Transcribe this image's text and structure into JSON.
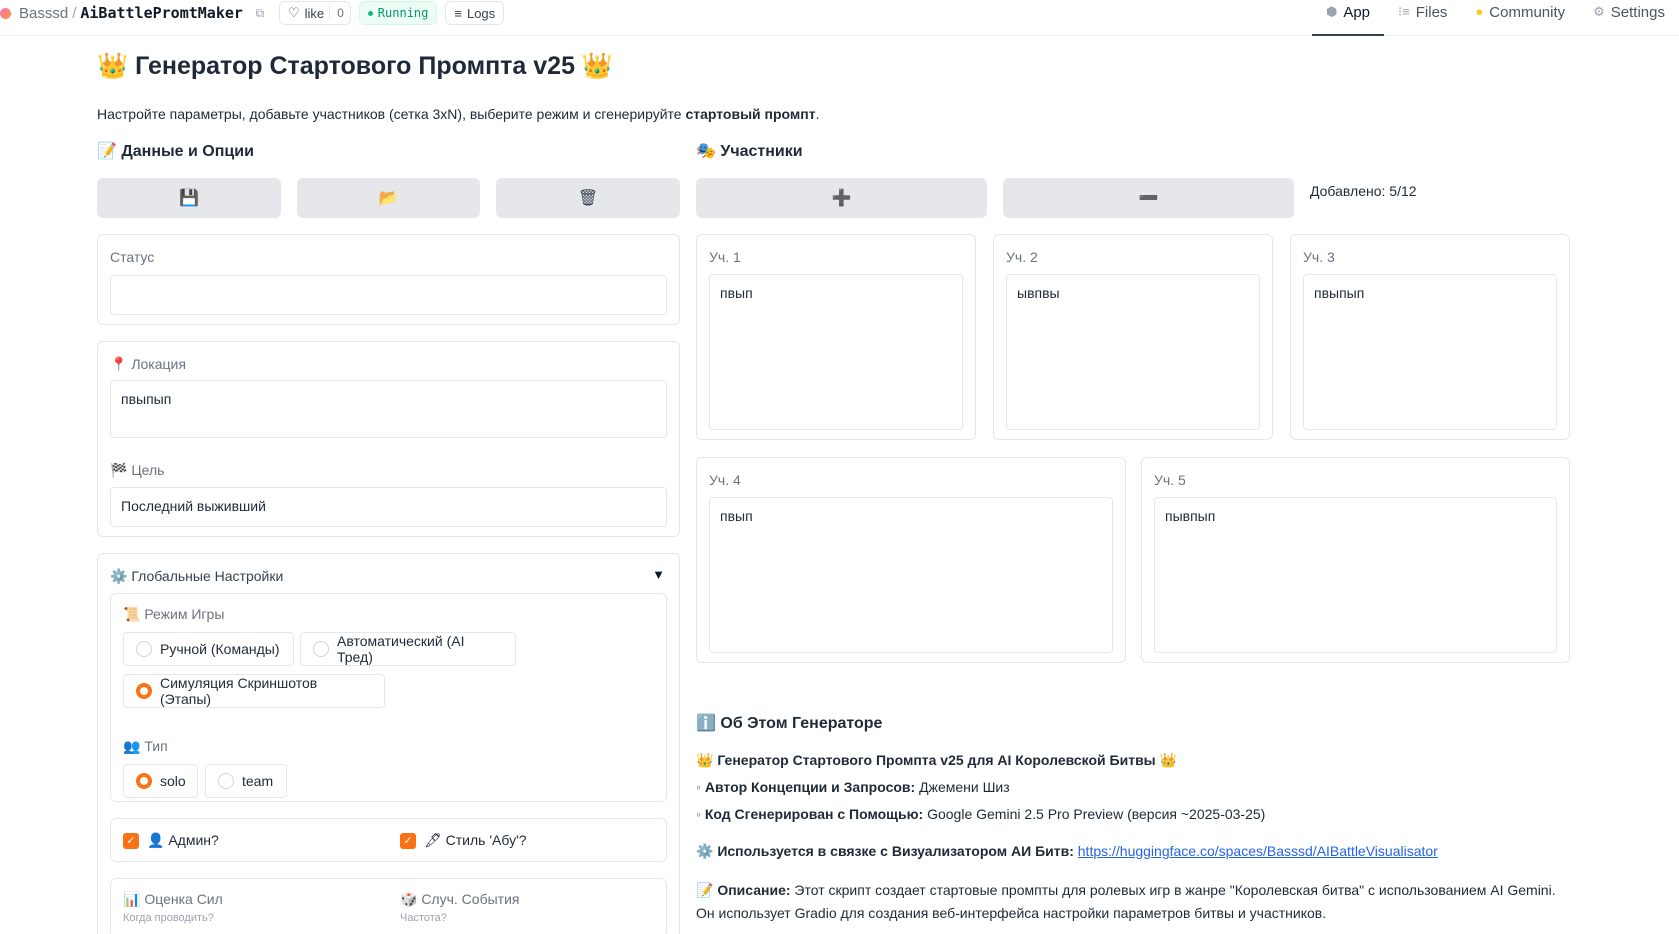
{
  "topbar": {
    "owner": "Basssd",
    "separator": "/",
    "repo": "AiBattlePromtMaker",
    "copy_icon": "⧉",
    "like_icon": "♡",
    "like_label": "like",
    "like_count": "0",
    "status_label": "Running",
    "logs_icon": "≡",
    "logs_label": "Logs",
    "tabs": [
      {
        "icon": "⬢",
        "label": "App"
      },
      {
        "icon": "⁝≡",
        "label": "Files"
      },
      {
        "icon": "●",
        "label": "Community"
      },
      {
        "icon": "⚙",
        "label": "Settings"
      }
    ]
  },
  "page": {
    "title": "👑 Генератор Стартового Промпта v25 👑",
    "description_prefix": "Настройте параметры, добавьте участников (сетка 3xN), выберите режим и сгенерируйте ",
    "description_bold": "стартовый промпт",
    "description_suffix": "."
  },
  "data_options": {
    "heading": "📝 Данные и Опции",
    "save_icon": "💾",
    "load_icon": "📂",
    "delete_icon": "🗑",
    "status_label": "Статус",
    "status_value": "",
    "location_label": "📍 Локация",
    "location_value": "пвыпып",
    "goal_label": "🏁 Цель",
    "goal_value": "Последний выживший",
    "global_settings_label": "⚙️ Глобальные Настройки",
    "collapse_icon": "▼",
    "mode_label": "📜 Режим Игры",
    "mode_options": [
      "Ручной (Команды)",
      "Автоматический (AI Тред)",
      "Симуляция Скриншотов (Этапы)"
    ],
    "mode_selected": "Симуляция Скриншотов (Этапы)",
    "type_label": "👥 Тип",
    "type_options": [
      "solo",
      "team"
    ],
    "type_selected": "solo",
    "admin_label": "👤 Админ?",
    "admin_checked": true,
    "abu_label": "🖋 Стиль 'Абу'?",
    "abu_checked": true,
    "check_mark": "✓",
    "power_label": "📊 Оценка Сил",
    "power_sub": "Когда проводить?",
    "events_label": "🎲 Случ. События",
    "events_sub": "Частота?"
  },
  "participants": {
    "heading": "🎭 Участники",
    "add_icon": "➕",
    "remove_icon": "➖",
    "counter": "Добавлено: 5/12",
    "items": [
      {
        "label": "Уч. 1",
        "value": "пвып"
      },
      {
        "label": "Уч. 2",
        "value": "ывпвы"
      },
      {
        "label": "Уч. 3",
        "value": "пвыпып"
      },
      {
        "label": "Уч. 4",
        "value": "пвып"
      },
      {
        "label": "Уч. 5",
        "value": "пывпып"
      }
    ]
  },
  "about": {
    "heading": "ℹ️ Об Этом Генераторе",
    "subtitle": "👑 Генератор Стартового Промпта v25 для AI Королевской Битвы 👑",
    "bullet": "◦",
    "author_label": "Автор Концепции и Запросов:",
    "author_value": " Джемени Шиз",
    "code_label": "Код Сгенерирован с Помощью:",
    "code_value": " Google Gemini 2.5 Pro Preview (версия ~2025-03-25)",
    "used_label": "⚙️ Используется в связке с Визуализатором АИ Битв:",
    "used_link": "https://huggingface.co/spaces/Basssd/AIBattleVisualisator",
    "desc_label": "📝 Описание:",
    "desc_line1": " Этот скрипт создает стартовые промпты для ролевых игр в жанре \"Королевская битва\" с использованием AI Gemini.",
    "desc_line2": "Он использует Gradio для создания веб-интерфейса настройки параметров битвы и участников."
  }
}
